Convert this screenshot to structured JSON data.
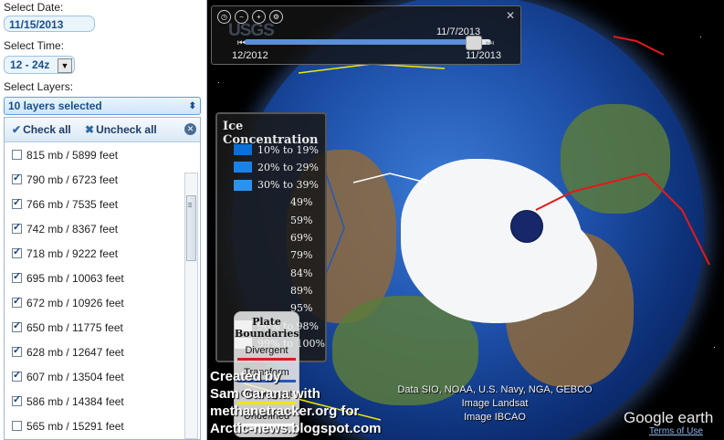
{
  "left_panel": {
    "date_label": "Select Date:",
    "date_value": "11/15/2013",
    "time_label": "Select Time:",
    "time_value": "12 - 24z",
    "layers_label": "Select Layers:",
    "layers_value": "10 layers selected",
    "check_all": "Check all",
    "uncheck_all": "Uncheck all",
    "layers": [
      {
        "label": "815 mb / 5899 feet",
        "checked": false
      },
      {
        "label": "790 mb / 6723 feet",
        "checked": true
      },
      {
        "label": "766 mb / 7535 feet",
        "checked": true
      },
      {
        "label": "742 mb / 8367 feet",
        "checked": true
      },
      {
        "label": "718 mb / 9222 feet",
        "checked": true
      },
      {
        "label": "695 mb / 10063 feet",
        "checked": true
      },
      {
        "label": "672 mb / 10926 feet",
        "checked": true
      },
      {
        "label": "650 mb / 11775 feet",
        "checked": true
      },
      {
        "label": "628 mb / 12647 feet",
        "checked": true
      },
      {
        "label": "607 mb / 13504 feet",
        "checked": true
      },
      {
        "label": "586 mb / 14384 feet",
        "checked": true
      },
      {
        "label": "565 mb / 15291 feet",
        "checked": false
      }
    ]
  },
  "timeline": {
    "watermark": "USGS",
    "current": "11/7/2013",
    "start": "12/2012",
    "end": "11/2013",
    "progress": 0.96
  },
  "ice_legend": {
    "title": "Ice Concentration",
    "rows": [
      {
        "label": "10% to 19%",
        "color": "#0a6fd6"
      },
      {
        "label": "20% to 29%",
        "color": "#1a82e6"
      },
      {
        "label": "30% to 39%",
        "color": "#2b93ee"
      },
      {
        "label": "49%",
        "color": "#3fa2f0"
      },
      {
        "label": "59%",
        "color": "#5cb3f2"
      },
      {
        "label": "69%",
        "color": "#7ac2f4"
      },
      {
        "label": "79%",
        "color": "#9ad1f6"
      },
      {
        "label": "84%",
        "color": "#b8def8"
      },
      {
        "label": "89%",
        "color": "#d4eafa"
      },
      {
        "label": "95%",
        "color": "#e8f3fc"
      },
      {
        "label": "96% to 98%",
        "color": "#f4f9fe"
      },
      {
        "label": "99% to 100%",
        "color": "#ffffff"
      }
    ]
  },
  "plate_legend": {
    "title_1": "Plate",
    "title_2": "Boundaries",
    "items": [
      {
        "label": "Divergent",
        "color": "#e01b1b"
      },
      {
        "label": "Transform",
        "color": "#2657b8"
      },
      {
        "label": "Convergent",
        "color": "#f2e600"
      },
      {
        "label": "Undefined",
        "color": "#ffffff"
      }
    ]
  },
  "credits": {
    "line1": "Created by",
    "line2": "Sam Carana with",
    "line3": "methanetracker.org for",
    "line4": "Arctic-news.blogspot.com"
  },
  "attribution": {
    "line1": "Data SIO, NOAA, U.S. Navy, NGA, GEBCO",
    "line2": "Image Landsat",
    "line3": "Image IBCAO"
  },
  "brand": {
    "logo": "Google earth",
    "terms": "Terms of Use"
  }
}
